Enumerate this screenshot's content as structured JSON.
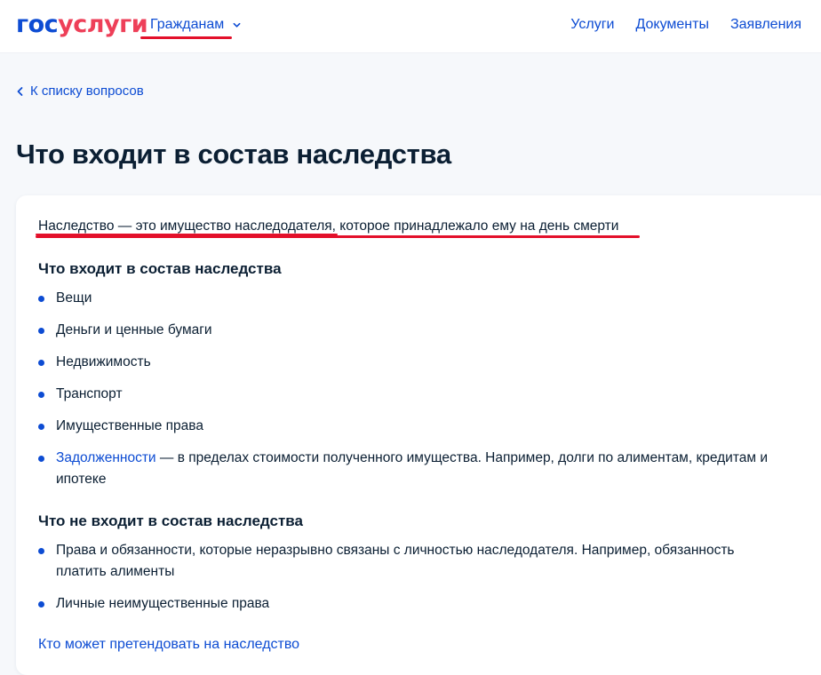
{
  "header": {
    "logo_part1": "гос",
    "logo_part2": "услуги",
    "nav_citizens": "Гражданам",
    "links": [
      "Услуги",
      "Документы",
      "Заявления"
    ]
  },
  "back_link": "К списку вопросов",
  "page_title": "Что входит в состав наследства",
  "intro": "Наследство — это имущество наследодателя, которое принадлежало ему на день смерти",
  "included": {
    "title": "Что входит в состав наследства",
    "items": [
      "Вещи",
      "Деньги и ценные бумаги",
      "Недвижимость",
      "Транспорт",
      "Имущественные права"
    ],
    "debt_link": "Задолженности",
    "debt_text_line1": " — в пределах стоимости полученного имущества. Например, долги по алиментам, кредитам и",
    "debt_text_line2": "ипотеке"
  },
  "excluded": {
    "title": "Что не входит в состав наследства",
    "item1_line1": "Права и обязанности, которые неразрывно связаны с личностью наследодателя. Например, обязанность",
    "item1_line2": "платить алименты",
    "item2": "Личные неимущественные права"
  },
  "next_link": "Кто может претендовать на наследство",
  "colors": {
    "brand_blue": "#0d4cd3",
    "brand_red": "#ee3f58",
    "annotation_red": "#e3102a"
  }
}
